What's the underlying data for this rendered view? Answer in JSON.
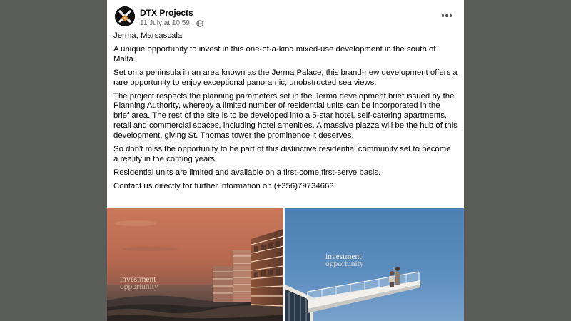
{
  "post": {
    "page_name": "DTX Projects",
    "timestamp": "11 July at 10:59",
    "separator": "·",
    "privacy_icon": "globe-icon",
    "more_icon": "more-horizontal-icon",
    "paragraphs": [
      "Jerma, Marsascala",
      "A unique opportunity to invest in this one-of-a-kind mixed-use development in the south of Malta.",
      "Set on a peninsula in an area known as the Jerma Palace, this brand-new development offers a rare opportunity to enjoy exceptional panoramic, unobstructed sea views.",
      "The project respects the planning parameters set in the Jerma development brief issued by the Planning Authority, whereby a limited number of residential units can be incorporated in the brief area. The rest of the site is to be developed into a 5-star hotel, self-catering apartments, retail and commercial spaces, including hotel amenities. A massive piazza will be the hub of this development, giving St. Thomas tower the prominence it deserves.",
      "So don't miss the opportunity to be part of this distinctive residential community set to become a reality in the coming years.",
      "Residential units are limited and available on a first-come first-serve basis.",
      "Contact us directly for further information on (+356)79734663"
    ]
  },
  "media": {
    "left_image": {
      "overlay_line1": "investment",
      "overlay_line2": "opportunity"
    },
    "right_image": {
      "overlay_line1": "investment",
      "overlay_line2": "opportunity"
    }
  },
  "colors": {
    "backdrop": "#5b5d58",
    "card": "#ffffff",
    "text": "#050505",
    "secondary_text": "#65676b"
  }
}
